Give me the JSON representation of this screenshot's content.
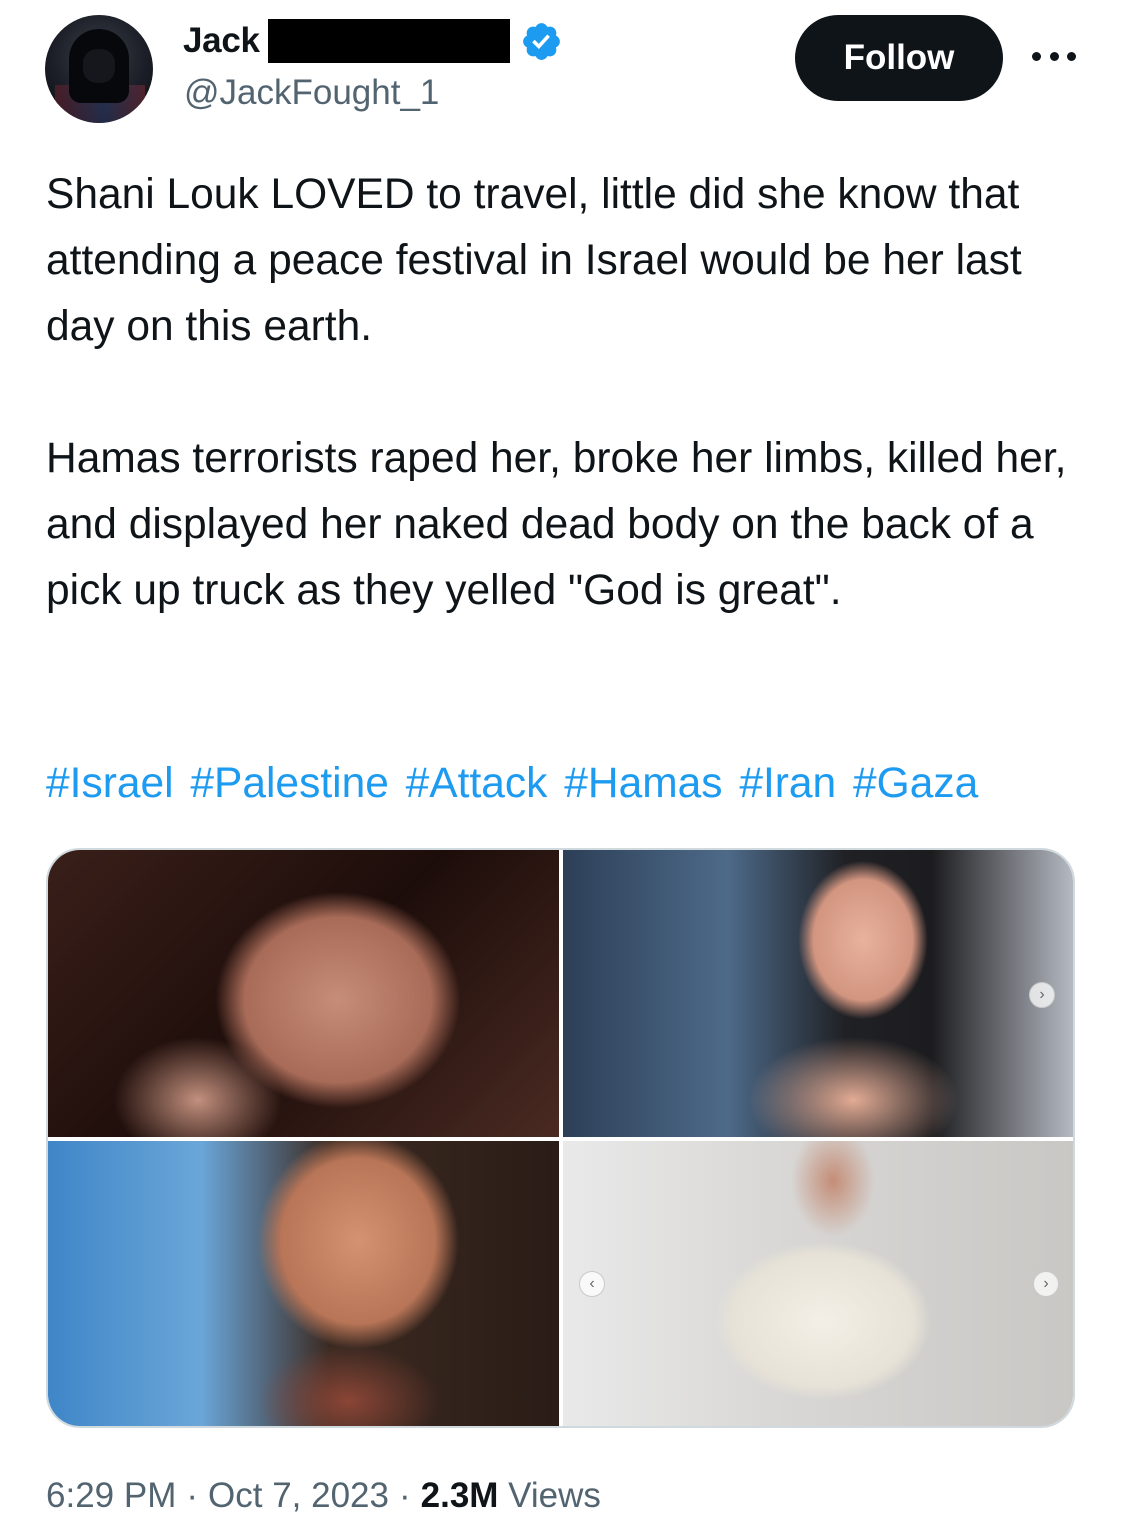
{
  "author": {
    "display_name": "Jack",
    "handle": "@JackFought_1",
    "verified": true,
    "verified_color": "#1d9bf0"
  },
  "actions": {
    "follow_label": "Follow",
    "more_icon": "more-horizontal-icon"
  },
  "tweet": {
    "text": "Shani Louk LOVED to travel, little did she know that attending a peace festival in Israel would be her last day on this earth.\n\nHamas terrorists raped her, broke her limbs, killed her, and displayed her naked dead body on the back of a pick up truck as they yelled \"God is great\".",
    "hashtags": [
      "#Israel",
      "#Palestine",
      "#Attack",
      "#Hamas",
      "#Iran",
      "#Gaza"
    ],
    "hashtag_color": "#1d9bf0"
  },
  "media": {
    "count": 4
  },
  "meta": {
    "time": "6:29 PM",
    "date": "Oct 7, 2023",
    "separator": "·",
    "views_count": "2.3M",
    "views_label": "Views"
  }
}
